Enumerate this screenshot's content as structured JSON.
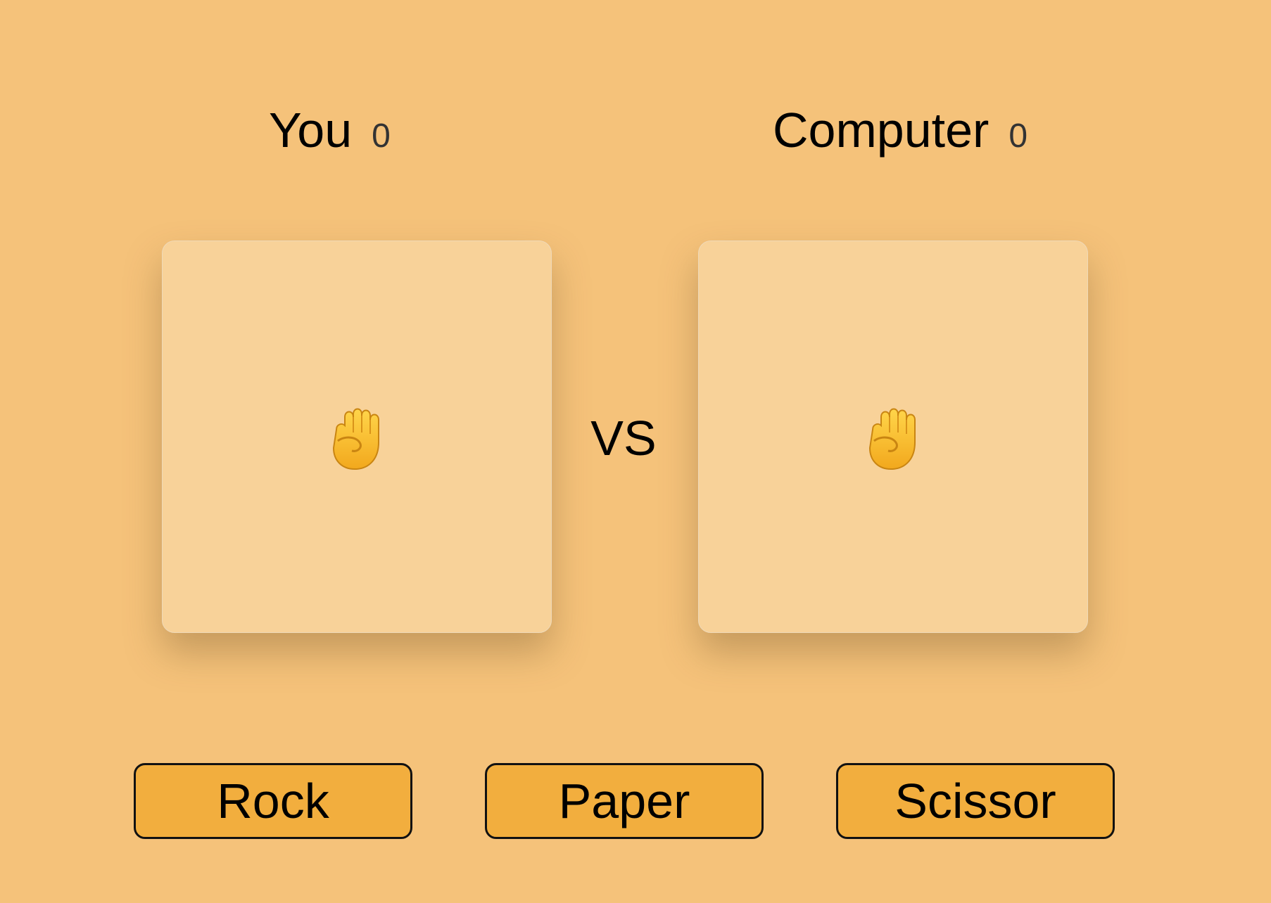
{
  "scoreboard": {
    "player_label": "You",
    "player_score": "0",
    "computer_label": "Computer",
    "computer_score": "0"
  },
  "arena": {
    "player_choice_icon": "raised-fist-icon",
    "computer_choice_icon": "raised-fist-icon",
    "vs_label": "VS"
  },
  "controls": {
    "rock_label": "Rock",
    "paper_label": "Paper",
    "scissor_label": "Scissor"
  },
  "colors": {
    "background": "#F5C27A",
    "card": "#F8D299",
    "button": "#F2AE3E"
  }
}
